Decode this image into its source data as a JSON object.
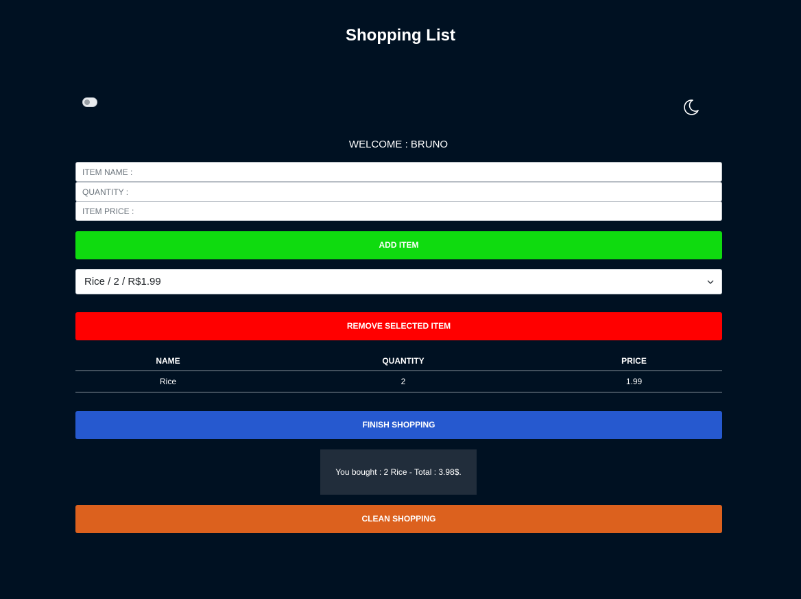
{
  "header": {
    "title": "Shopping List"
  },
  "theme": {
    "mode_icon": "moon-icon",
    "toggle_state": "off"
  },
  "welcome": {
    "text": "WELCOME : BRUNO"
  },
  "form": {
    "item_name_placeholder": "ITEM NAME :",
    "quantity_placeholder": "QUANTITY :",
    "item_price_placeholder": "ITEM PRICE :",
    "add_button_label": "ADD ITEM"
  },
  "selector": {
    "selected": "Rice / 2 / R$1.99",
    "icon": "chevron-down-icon"
  },
  "remove_button_label": "REMOVE SELECTED ITEM",
  "table": {
    "headers": {
      "name": "NAME",
      "quantity": "QUANTITY",
      "price": "PRICE"
    },
    "rows": [
      {
        "name": "Rice",
        "quantity": "2",
        "price": "1.99"
      }
    ]
  },
  "finish_button_label": "FINISH SHOPPING",
  "summary": {
    "text": "You bought : 2 Rice - Total : 3.98$."
  },
  "clean_button_label": "CLEAN SHOPPING",
  "colors": {
    "background": "#001122",
    "add": "#0fdb0f",
    "remove": "#ff0000",
    "finish": "#2659cf",
    "clean": "#dc611e",
    "summary_bg": "#212d3b"
  }
}
